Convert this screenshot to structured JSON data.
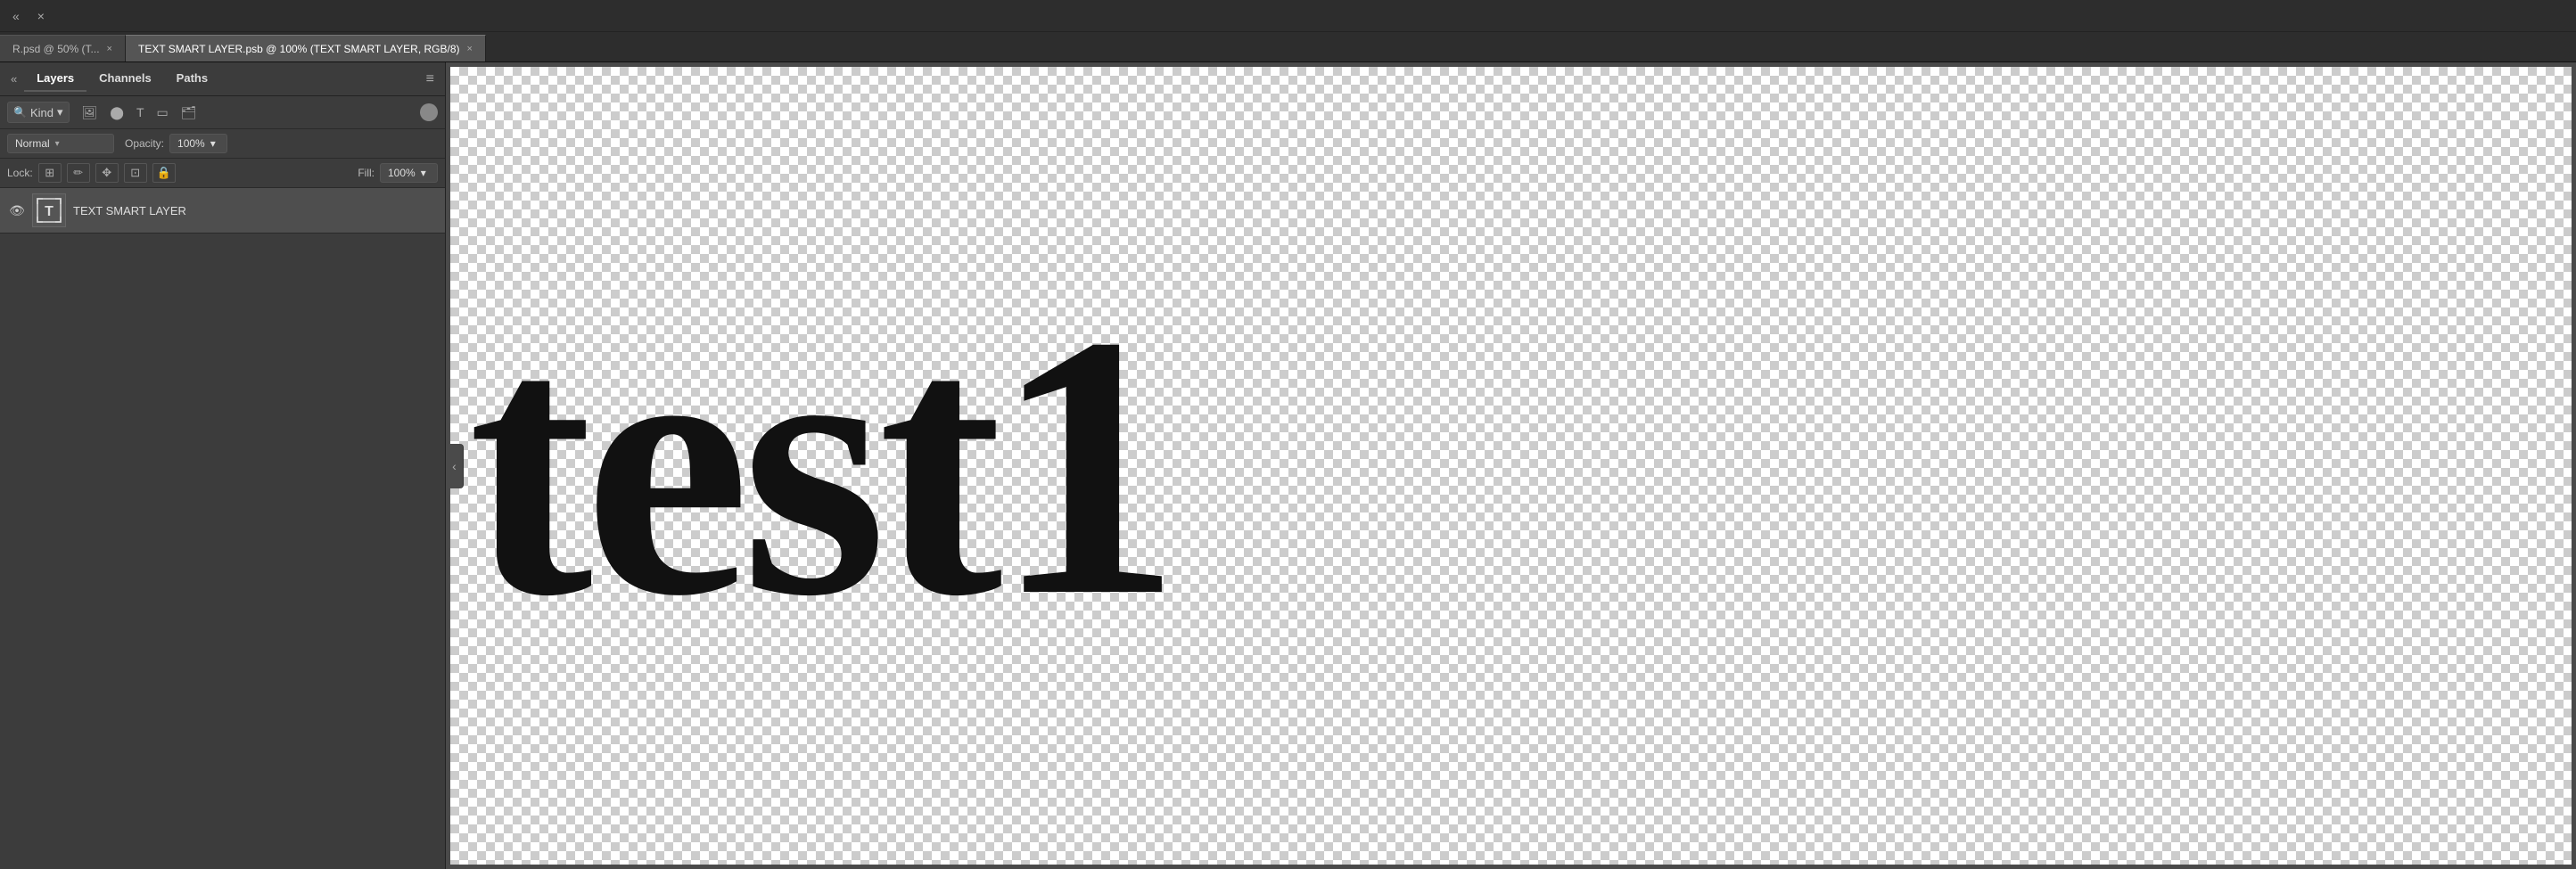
{
  "topBar": {
    "collapseLabel": "«",
    "closeLabel": "×"
  },
  "tabs": [
    {
      "id": "tab1",
      "label": "R.psd @ 50% (T...",
      "active": false,
      "closeLabel": "×"
    },
    {
      "id": "tab2",
      "label": "TEXT SMART LAYER.psb @ 100% (TEXT SMART LAYER, RGB/8)",
      "active": true,
      "closeLabel": "×"
    }
  ],
  "panel": {
    "tabs": [
      {
        "id": "layers",
        "label": "Layers",
        "active": true
      },
      {
        "id": "channels",
        "label": "Channels",
        "active": false
      },
      {
        "id": "paths",
        "label": "Paths",
        "active": false
      }
    ],
    "menuIcon": "≡",
    "filter": {
      "searchIcon": "🔍",
      "kindLabel": "Kind",
      "kindChevron": "▾",
      "icons": [
        "🖼",
        "⬤",
        "T",
        "▭",
        "🗂"
      ]
    },
    "blendMode": {
      "value": "Normal",
      "chevron": "▾"
    },
    "opacity": {
      "label": "Opacity:",
      "value": "100%",
      "chevron": "▾"
    },
    "lock": {
      "label": "Lock:",
      "icons": [
        "⊞",
        "✏",
        "✥",
        "⊡",
        "🔒"
      ]
    },
    "fill": {
      "label": "Fill:",
      "value": "100%",
      "chevron": "▾"
    },
    "layers": [
      {
        "id": "layer1",
        "visible": true,
        "name": "TEXT SMART LAYER",
        "type": "text-smart"
      }
    ],
    "collapseArrow": "‹"
  },
  "canvas": {
    "text": "test1"
  }
}
